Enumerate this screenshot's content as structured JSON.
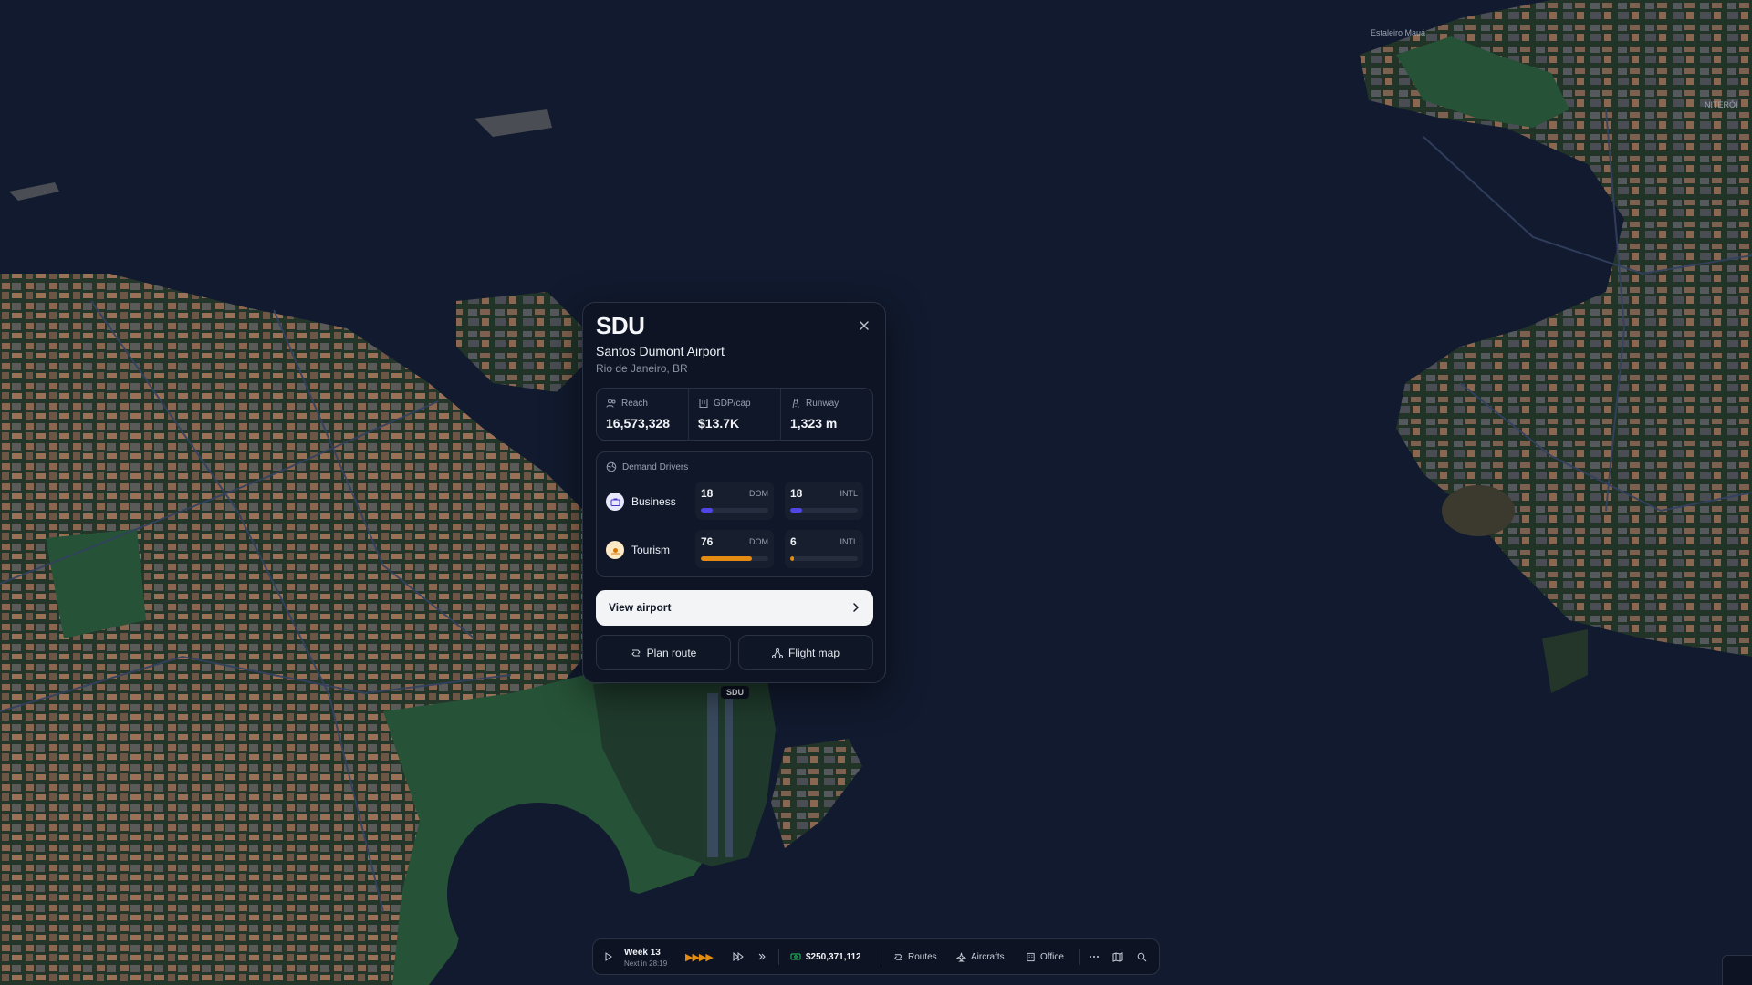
{
  "map": {
    "labels": [
      "Estaleiro Mauá",
      "NITERÓI"
    ]
  },
  "airport": {
    "code": "SDU",
    "name": "Santos Dumont Airport",
    "location": "Rio de Janeiro, BR",
    "pin_label": "SDU",
    "stats": [
      {
        "label": "Reach",
        "value": "16,573,328",
        "icon": "users-icon"
      },
      {
        "label": "GDP/cap",
        "value": "$13.7K",
        "icon": "building-icon"
      },
      {
        "label": "Runway",
        "value": "1,323 m",
        "icon": "runway-icon"
      }
    ],
    "demand": {
      "title": "Demand Drivers",
      "rows": [
        {
          "name": "Business",
          "icon": "briefcase-icon",
          "icon_bg": "#e8e9ff",
          "icon_color": "#4338ca",
          "dom": {
            "value": "18",
            "tag": "DOM",
            "fraction": 0.18,
            "color": "#4f46e5"
          },
          "intl": {
            "value": "18",
            "tag": "INTL",
            "fraction": 0.18,
            "color": "#4f46e5"
          }
        },
        {
          "name": "Tourism",
          "icon": "sun-icon",
          "icon_bg": "#fdebc8",
          "icon_color": "#d97706",
          "dom": {
            "value": "76",
            "tag": "DOM",
            "fraction": 0.76,
            "color": "#e38b12"
          },
          "intl": {
            "value": "6",
            "tag": "INTL",
            "fraction": 0.06,
            "color": "#e38b12"
          }
        }
      ]
    },
    "primary_button": "View airport",
    "plan_route": "Plan route",
    "flight_map": "Flight map"
  },
  "toolbar": {
    "week": "Week 13",
    "next": "Next in 28:19",
    "speed": "▶▶▶▶",
    "balance": "$250,371,112",
    "routes": "Routes",
    "aircrafts": "Aircrafts",
    "office": "Office"
  },
  "colors": {
    "water": "#111a2e",
    "land": "#1e3327",
    "park": "#265237",
    "building_warm": "#8b6650",
    "building_grey": "#4a4e54",
    "road": "#334160",
    "accent_orange": "#e38b12",
    "accent_indigo": "#4f46e5"
  }
}
